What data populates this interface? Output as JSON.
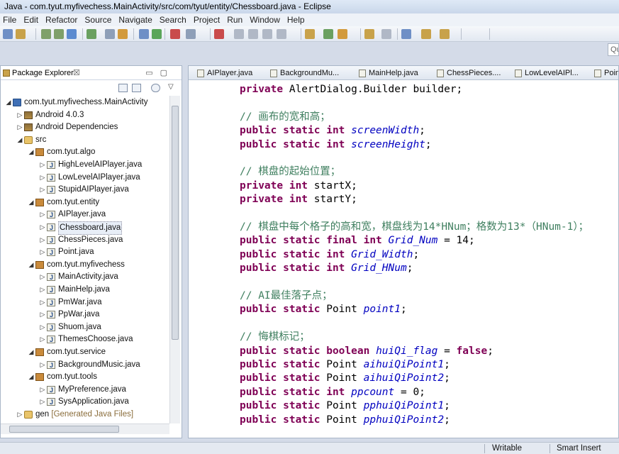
{
  "window": {
    "title": "Java - com.tyut.myfivechess.MainActivity/src/com/tyut/entity/Chessboard.java - Eclipse"
  },
  "menu": [
    "File",
    "Edit",
    "Refactor",
    "Source",
    "Navigate",
    "Search",
    "Project",
    "Run",
    "Window",
    "Help"
  ],
  "search_box": {
    "value": "Qu"
  },
  "package_explorer": {
    "title": "Package Explorer",
    "close_glyph": "☒",
    "tree": [
      {
        "label": "com.tyut.myfivechess.MainActivity",
        "icon": "project-icon",
        "arrow": "◢",
        "indent": 0
      },
      {
        "label": "Android 4.0.3",
        "icon": "library-icon",
        "arrow": "▷",
        "indent": 1
      },
      {
        "label": "Android Dependencies",
        "icon": "library-icon",
        "arrow": "▷",
        "indent": 1
      },
      {
        "label": "src",
        "icon": "source-folder-icon",
        "arrow": "◢",
        "indent": 1
      },
      {
        "label": "com.tyut.algo",
        "icon": "package-icon",
        "arrow": "◢",
        "indent": 2
      },
      {
        "label": "HighLevelAIPlayer.java",
        "icon": "java-file-icon",
        "arrow": "▷",
        "indent": 3
      },
      {
        "label": "LowLevelAIPlayer.java",
        "icon": "java-file-icon",
        "arrow": "▷",
        "indent": 3
      },
      {
        "label": "StupidAIPlayer.java",
        "icon": "java-file-icon",
        "arrow": "▷",
        "indent": 3
      },
      {
        "label": "com.tyut.entity",
        "icon": "package-icon",
        "arrow": "◢",
        "indent": 2
      },
      {
        "label": "AIPlayer.java",
        "icon": "java-file-icon",
        "arrow": "▷",
        "indent": 3
      },
      {
        "label": "Chessboard.java",
        "icon": "java-file-icon",
        "arrow": "▷",
        "indent": 3,
        "selected": true
      },
      {
        "label": "ChessPieces.java",
        "icon": "java-file-icon",
        "arrow": "▷",
        "indent": 3
      },
      {
        "label": "Point.java",
        "icon": "java-file-icon",
        "arrow": "▷",
        "indent": 3
      },
      {
        "label": "com.tyut.myfivechess",
        "icon": "package-icon",
        "arrow": "◢",
        "indent": 2
      },
      {
        "label": "MainActivity.java",
        "icon": "java-file-icon",
        "arrow": "▷",
        "indent": 3
      },
      {
        "label": "MainHelp.java",
        "icon": "java-file-icon",
        "arrow": "▷",
        "indent": 3
      },
      {
        "label": "PmWar.java",
        "icon": "java-file-icon",
        "arrow": "▷",
        "indent": 3
      },
      {
        "label": "PpWar.java",
        "icon": "java-file-icon",
        "arrow": "▷",
        "indent": 3
      },
      {
        "label": "Shuom.java",
        "icon": "java-file-icon",
        "arrow": "▷",
        "indent": 3
      },
      {
        "label": "ThemesChoose.java",
        "icon": "java-file-icon",
        "arrow": "▷",
        "indent": 3
      },
      {
        "label": "com.tyut.service",
        "icon": "package-icon",
        "arrow": "◢",
        "indent": 2
      },
      {
        "label": "BackgroundMusic.java",
        "icon": "java-file-icon",
        "arrow": "▷",
        "indent": 3
      },
      {
        "label": "com.tyut.tools",
        "icon": "package-icon",
        "arrow": "◢",
        "indent": 2
      },
      {
        "label": "MyPreference.java",
        "icon": "java-file-icon",
        "arrow": "▷",
        "indent": 3
      },
      {
        "label": "SysApplication.java",
        "icon": "java-file-icon",
        "arrow": "▷",
        "indent": 3
      },
      {
        "label": "gen",
        "icon": "gen-folder-icon",
        "arrow": "▷",
        "indent": 1,
        "suffix": "[Generated Java Files]"
      }
    ]
  },
  "editor": {
    "tabs": [
      "AIPlayer.java",
      "BackgroundMu...",
      "MainHelp.java",
      "ChessPieces....",
      "LowLevelAIPl...",
      "Point"
    ],
    "lines": [
      [
        [
          "kw",
          "private "
        ],
        [
          "plain",
          "AlertDialog.Builder builder;"
        ]
      ],
      [],
      [
        [
          "cm",
          "// 画布的宽和高；"
        ]
      ],
      [
        [
          "kw",
          "public static int "
        ],
        [
          "fld",
          "screenWidth"
        ],
        [
          "plain",
          ";"
        ]
      ],
      [
        [
          "kw",
          "public static int "
        ],
        [
          "fld",
          "screenHeight"
        ],
        [
          "plain",
          ";"
        ]
      ],
      [],
      [
        [
          "cm",
          "// 棋盘的起始位置；"
        ]
      ],
      [
        [
          "kw",
          "private int "
        ],
        [
          "plain",
          "startX;"
        ]
      ],
      [
        [
          "kw",
          "private int "
        ],
        [
          "plain",
          "startY;"
        ]
      ],
      [],
      [
        [
          "cm",
          "// 棋盘中每个格子的高和宽，棋盘线为14*HNum；格数为13*（HNum-1）；"
        ]
      ],
      [
        [
          "kw",
          "public static final int "
        ],
        [
          "fld",
          "Grid_Num"
        ],
        [
          "plain",
          " = 14;"
        ]
      ],
      [
        [
          "kw",
          "public static int "
        ],
        [
          "fld",
          "Grid_Width"
        ],
        [
          "plain",
          ";"
        ]
      ],
      [
        [
          "kw",
          "public static int "
        ],
        [
          "fld",
          "Grid_HNum"
        ],
        [
          "plain",
          ";"
        ]
      ],
      [],
      [
        [
          "cm",
          "// AI最佳落子点；"
        ]
      ],
      [
        [
          "kw",
          "public static "
        ],
        [
          "plain",
          "Point "
        ],
        [
          "fld",
          "point1"
        ],
        [
          "plain",
          ";"
        ]
      ],
      [],
      [
        [
          "cm",
          "// 悔棋标记；"
        ]
      ],
      [
        [
          "kw",
          "public static boolean "
        ],
        [
          "fld",
          "huiQi_flag"
        ],
        [
          "plain",
          " = "
        ],
        [
          "kw",
          "false"
        ],
        [
          "plain",
          ";"
        ]
      ],
      [
        [
          "kw",
          "public static "
        ],
        [
          "plain",
          "Point "
        ],
        [
          "fld",
          "aihuiQiPoint1"
        ],
        [
          "plain",
          ";"
        ]
      ],
      [
        [
          "kw",
          "public static "
        ],
        [
          "plain",
          "Point "
        ],
        [
          "fld",
          "aihuiQiPoint2"
        ],
        [
          "plain",
          ";"
        ]
      ],
      [
        [
          "kw",
          "public static int "
        ],
        [
          "fld",
          "ppcount"
        ],
        [
          "plain",
          " = 0;"
        ]
      ],
      [
        [
          "kw",
          "public static "
        ],
        [
          "plain",
          "Point "
        ],
        [
          "fld",
          "pphuiQiPoint1"
        ],
        [
          "plain",
          ";"
        ]
      ],
      [
        [
          "kw",
          "public static "
        ],
        [
          "plain",
          "Point "
        ],
        [
          "fld",
          "pphuiQiPoint2"
        ],
        [
          "plain",
          ";"
        ]
      ]
    ]
  },
  "status": {
    "writable": "Writable",
    "insert_mode": "Smart Insert"
  },
  "colors": {
    "keyword": "#7f0055",
    "comment": "#3f7f5f",
    "field": "#0000c0"
  }
}
